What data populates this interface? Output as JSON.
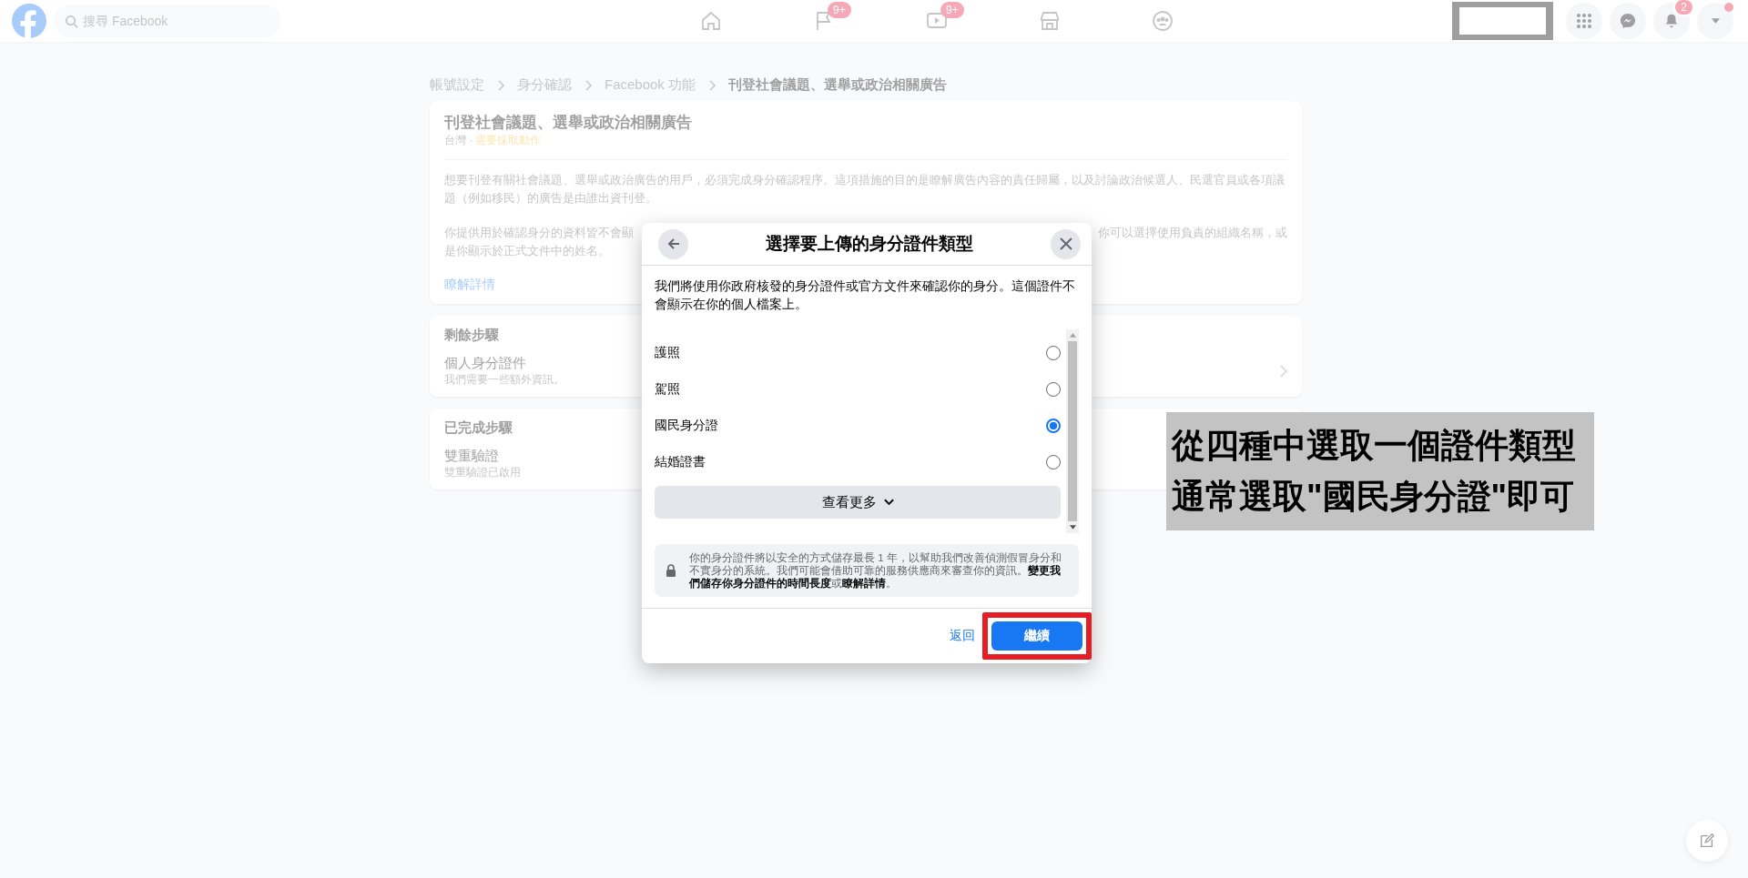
{
  "top_bar": {
    "search": {
      "placeholder": "搜尋 Facebook"
    },
    "nav": [
      {
        "kind": "home"
      },
      {
        "kind": "flag",
        "badge": "9+"
      },
      {
        "kind": "video",
        "badge": "9+"
      },
      {
        "kind": "store"
      },
      {
        "kind": "groups"
      }
    ],
    "notifications_badge": "2"
  },
  "breadcrumb": [
    {
      "label": "帳號設定",
      "current": false
    },
    {
      "label": "身分確認",
      "current": false
    },
    {
      "label": "Facebook 功能",
      "current": false
    },
    {
      "label": "刊登社會議題、選舉或政治相關廣告",
      "current": true
    }
  ],
  "intro_card": {
    "title": "刊登社會議題、選舉或政治相關廣告",
    "region": "台灣 ·",
    "status": "需要採取動作",
    "paragraph_1": "想要刊登有關社會議題、選舉或政治廣告的用戶，必須完成身分確認程序。這項措施的目的是瞭解廣告內容的責任歸屬，以及討論政治候選人、民選官員或各項議題（例如移民）的廣告是由誰出資刊登。",
    "paragraph_2_left": "你提供用於確認身分的資料皆不會顯",
    "paragraph_2_right": "你可以選擇使用負責的組織名稱，或",
    "paragraph_2_end": "是你顯示於正式文件中的姓名。",
    "link": "瞭解詳情"
  },
  "remaining_steps": {
    "title": "剩餘步驟",
    "item": "個人身分證件",
    "subtitle": "我們需要一些額外資訊。"
  },
  "completed_steps": {
    "title": "已完成步驟",
    "item": "雙重驗證",
    "subtitle": "雙重驗證已啟用"
  },
  "modal": {
    "title": "選擇要上傳的身分證件類型",
    "description": "我們將使用你政府核發的身分證件或官方文件來確認你的身分。這個證件不會顯示在你的個人檔案上。",
    "options": [
      {
        "label": "護照",
        "selected": false
      },
      {
        "label": "駕照",
        "selected": false
      },
      {
        "label": "國民身分證",
        "selected": true
      },
      {
        "label": "結婚證書",
        "selected": false
      }
    ],
    "see_more": "查看更多",
    "note": "你的身分證件將以安全的方式儲存最長 1 年，以幫助我們改善偵測假冒身分和不實身分的系統。我們可能會借助可靠的服務供應商來審查你的資訊。**變更我們儲存你身分證件的時間長度**或**瞭解詳情**。",
    "back": "返回",
    "continue": "繼續"
  },
  "annotation": {
    "lines": [
      "從四種中選取一個證件類型",
      "通常選取\"國民身分證\"即可"
    ]
  }
}
